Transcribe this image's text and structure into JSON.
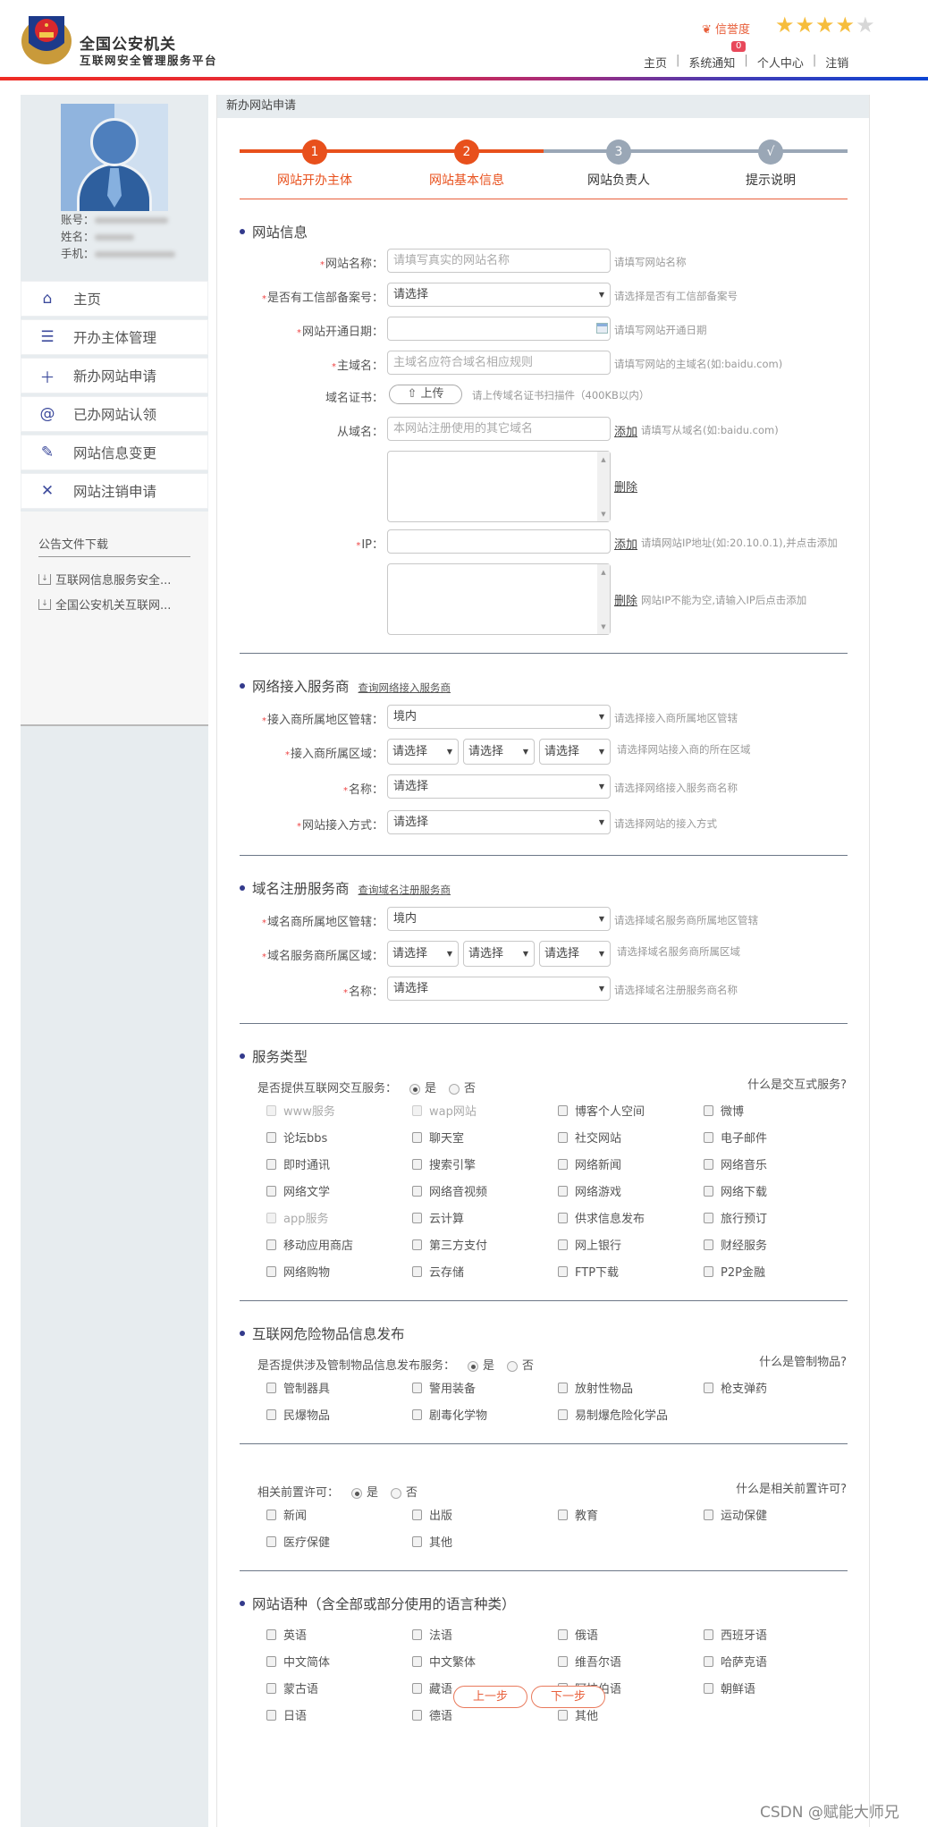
{
  "header": {
    "brand_title": "全国公安机关",
    "brand_subtitle": "互联网安全管理服务平台",
    "credit_label": "信誉度",
    "credit_rating": 4,
    "credit_max": 5,
    "notify_count": "0",
    "nav": [
      "主页",
      "系统通知",
      "个人中心",
      "注销"
    ],
    "colors": {
      "accent": "#e8603c",
      "star_on": "#f6bd3c",
      "star_off": "#d7d7d7",
      "brand_blue": "#333a8c"
    }
  },
  "profile": {
    "account_label": "账号：",
    "name_label": "姓名：",
    "phone_label": "手机："
  },
  "sidebar": {
    "items": [
      {
        "label": "主页",
        "icon": "home-icon"
      },
      {
        "label": "开办主体管理",
        "icon": "list-icon"
      },
      {
        "label": "新办网站申请",
        "icon": "plus-icon"
      },
      {
        "label": "已办网站认领",
        "icon": "at-icon"
      },
      {
        "label": "网站信息变更",
        "icon": "edit-icon"
      },
      {
        "label": "网站注销申请",
        "icon": "close-icon"
      }
    ],
    "downloads_title": "公告文件下载",
    "downloads": [
      "互联网信息服务安全...",
      "全国公安机关互联网..."
    ]
  },
  "main": {
    "breadcrumb": "新办网站申请",
    "steps": [
      {
        "num": "1",
        "label": "网站开办主体",
        "state": "done"
      },
      {
        "num": "2",
        "label": "网站基本信息",
        "state": "active"
      },
      {
        "num": "3",
        "label": "网站负责人",
        "state": "todo"
      },
      {
        "num": "√",
        "label": "提示说明",
        "state": "todo"
      }
    ],
    "site_info": {
      "title": "网站信息",
      "name_label": "网站名称：",
      "name_placeholder": "请填写真实的网站名称",
      "name_hint": "请填写网站名称",
      "icp_label": "是否有工信部备案号：",
      "icp_value": "请选择",
      "icp_hint": "请选择是否有工信部备案号",
      "date_label": "网站开通日期：",
      "date_value": "",
      "date_hint": "请填写网站开通日期",
      "domain_label": "主域名：",
      "domain_placeholder": "主域名应符合域名相应规则",
      "domain_hint": "请填写网站的主域名(如:baidu.com)",
      "cert_label": "域名证书：",
      "upload_label": "上传",
      "cert_hint": "请上传域名证书扫描件（400KB以内）",
      "subdomain_label": "从域名：",
      "subdomain_placeholder": "本网站注册使用的其它域名",
      "add_label": "添加",
      "subdomain_hint": "请填写从域名(如:baidu.com)",
      "delete_label": "删除",
      "ip_label": "IP：",
      "ip_value": "",
      "ip_hint": "请填网站IP地址(如:20.10.0.1),并点击添加",
      "ip_delete_hint": "网站IP不能为空,请输入IP后点击添加"
    },
    "isp": {
      "title": "网络接入服务商",
      "query_link": "查询网络接入服务商",
      "region_label": "接入商所属地区管辖：",
      "region_value": "境内",
      "region_hint": "请选择接入商所属地区管辖",
      "area_label": "接入商所属区域：",
      "area_values": [
        "请选择",
        "请选择",
        "请选择"
      ],
      "area_hint": "请选择网站接入商的所在区域",
      "name_label": "名称：",
      "name_value": "请选择",
      "name_hint": "请选择网络接入服务商名称",
      "mode_label": "网站接入方式：",
      "mode_value": "请选择",
      "mode_hint": "请选择网站的接入方式"
    },
    "registrar": {
      "title": "域名注册服务商",
      "query_link": "查询域名注册服务商",
      "region_label": "域名商所属地区管辖：",
      "region_value": "境内",
      "region_hint": "请选择域名服务商所属地区管辖",
      "area_label": "域名服务商所属区域：",
      "area_values": [
        "请选择",
        "请选择",
        "请选择"
      ],
      "area_hint": "请选择域名服务商所属区域",
      "name_label": "名称：",
      "name_value": "请选择",
      "name_hint": "请选择域名注册服务商名称"
    },
    "service": {
      "title": "服务类型",
      "question": "是否提供互联网交互服务：",
      "yes": "是",
      "no": "否",
      "selected": "是",
      "help": "什么是交互式服务?",
      "options": [
        {
          "label": "www服务",
          "disabled": true
        },
        {
          "label": "wap网站",
          "disabled": true
        },
        {
          "label": "博客个人空间"
        },
        {
          "label": "微博"
        },
        {
          "label": "论坛bbs"
        },
        {
          "label": "聊天室"
        },
        {
          "label": "社交网站"
        },
        {
          "label": "电子邮件"
        },
        {
          "label": "即时通讯"
        },
        {
          "label": "搜索引擎"
        },
        {
          "label": "网络新闻"
        },
        {
          "label": "网络音乐"
        },
        {
          "label": "网络文学"
        },
        {
          "label": "网络音视频"
        },
        {
          "label": "网络游戏"
        },
        {
          "label": "网络下载"
        },
        {
          "label": "app服务",
          "disabled": true
        },
        {
          "label": "云计算"
        },
        {
          "label": "供求信息发布"
        },
        {
          "label": "旅行预订"
        },
        {
          "label": "移动应用商店"
        },
        {
          "label": "第三方支付"
        },
        {
          "label": "网上银行"
        },
        {
          "label": "财经服务"
        },
        {
          "label": "网络购物"
        },
        {
          "label": "云存储"
        },
        {
          "label": "FTP下载"
        },
        {
          "label": "P2P金融"
        }
      ]
    },
    "dangerous": {
      "title": "互联网危险物品信息发布",
      "question": "是否提供涉及管制物品信息发布服务：",
      "yes": "是",
      "no": "否",
      "selected": "是",
      "help": "什么是管制物品?",
      "options": [
        "管制器具",
        "警用装备",
        "放射性物品",
        "枪支弹药",
        "民爆物品",
        "剧毒化学物",
        "易制爆危险化学品"
      ]
    },
    "permit": {
      "question": "相关前置许可：",
      "yes": "是",
      "no": "否",
      "selected": "是",
      "help": "什么是相关前置许可?",
      "options": [
        "新闻",
        "出版",
        "教育",
        "运动保健",
        "医疗保健",
        "其他"
      ]
    },
    "language": {
      "title": "网站语种（含全部或部分使用的语言种类）",
      "options": [
        "英语",
        "法语",
        "俄语",
        "西班牙语",
        "中文简体",
        "中文繁体",
        "维吾尔语",
        "哈萨克语",
        "蒙古语",
        "藏语",
        "阿拉伯语",
        "朝鲜语",
        "日语",
        "德语",
        "其他"
      ]
    },
    "prev_label": "上一步",
    "next_label": "下一步"
  },
  "watermark": "CSDN @赋能大师兄"
}
